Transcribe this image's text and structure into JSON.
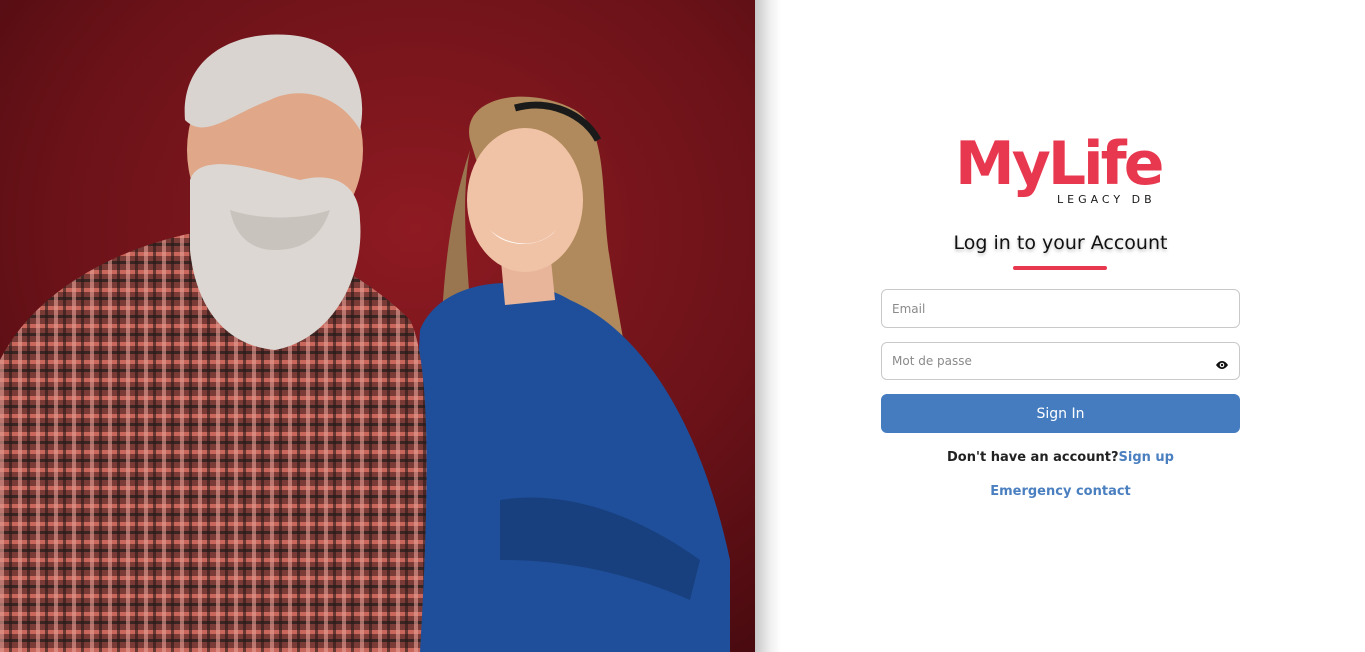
{
  "photo": {
    "description_icon": "people-photo",
    "background_color": "#6d1219"
  },
  "brand": {
    "name": "MyLife",
    "tagline": "LEGACY DB",
    "color": "#e8384f"
  },
  "login": {
    "title": "Log in to your Account",
    "email_placeholder": "Email",
    "password_placeholder": "Mot de passe",
    "show_password_icon": "eye-icon",
    "signin_label": "Sign In",
    "no_account_text": "Don't have an account?",
    "signup_link": "Sign up",
    "emergency_link": "Emergency contact"
  },
  "colors": {
    "accent": "#e8384f",
    "primary_button": "#457cc0",
    "link": "#4a7fc0"
  }
}
